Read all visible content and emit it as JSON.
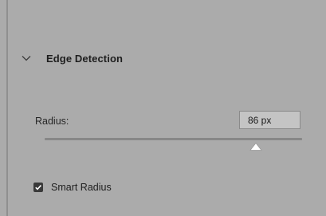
{
  "section": {
    "title": "Edge Detection",
    "expanded": true
  },
  "radius": {
    "label": "Radius:",
    "value": "86 px",
    "slider_fraction": 0.82
  },
  "smart_radius": {
    "label": "Smart Radius",
    "checked": true
  },
  "colors": {
    "panel_bg": "#ababab",
    "field_bg": "#c4c4c4",
    "track": "#878787",
    "thumb": "#ffffff",
    "checkbox": "#3a3a3a"
  },
  "icons": {
    "section_toggle": "chevron-down-icon",
    "checkbox_mark": "checkmark-icon"
  }
}
